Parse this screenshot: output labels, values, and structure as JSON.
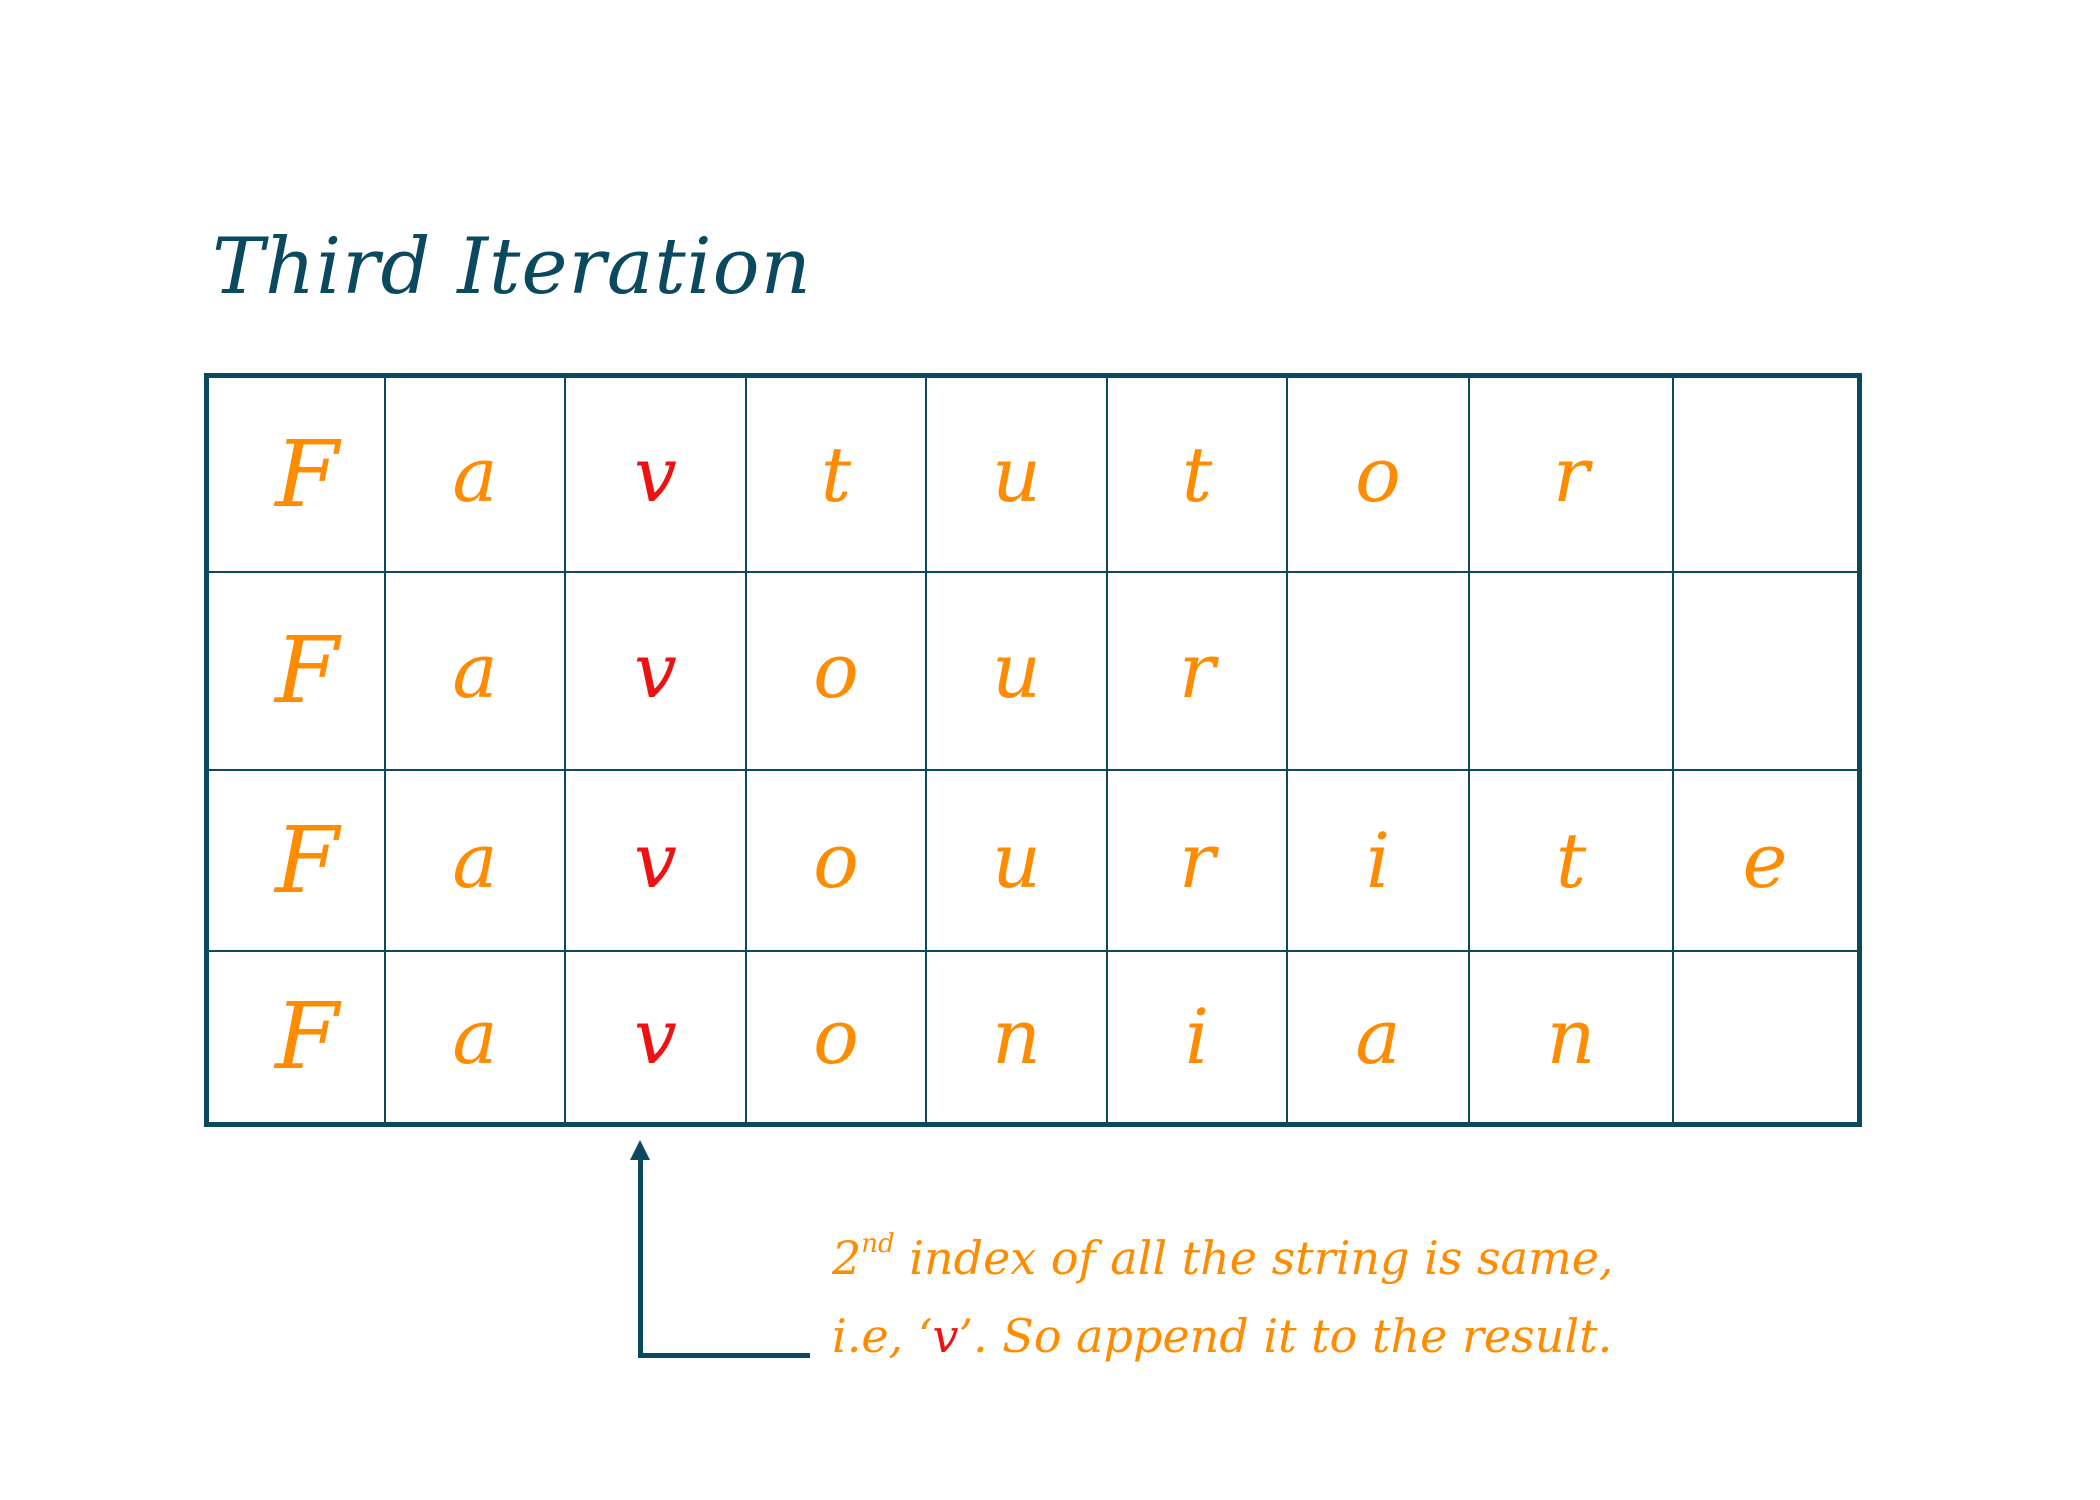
{
  "title": "Third Iteration",
  "colors": {
    "frame": "#0b4a5e",
    "letter": "#ff8c00",
    "highlight": "#ee1111"
  },
  "table": {
    "highlight_column": 2,
    "rows": [
      [
        "F",
        "a",
        "v",
        "t",
        "u",
        "t",
        "o",
        "r",
        ""
      ],
      [
        "F",
        "a",
        "v",
        "o",
        "u",
        "r",
        "",
        "",
        ""
      ],
      [
        "F",
        "a",
        "v",
        "o",
        "u",
        "r",
        "i",
        "t",
        "e"
      ],
      [
        "F",
        "a",
        "v",
        "o",
        "n",
        "i",
        "a",
        "n",
        ""
      ]
    ]
  },
  "annotation": {
    "line1_number": "2",
    "line1_sup": "nd",
    "line1_rest": " index of all the string is same,",
    "line2_prefix": "i.e, ‘",
    "line2_highlight": "v",
    "line2_suffix": "’. So append it to the result."
  }
}
